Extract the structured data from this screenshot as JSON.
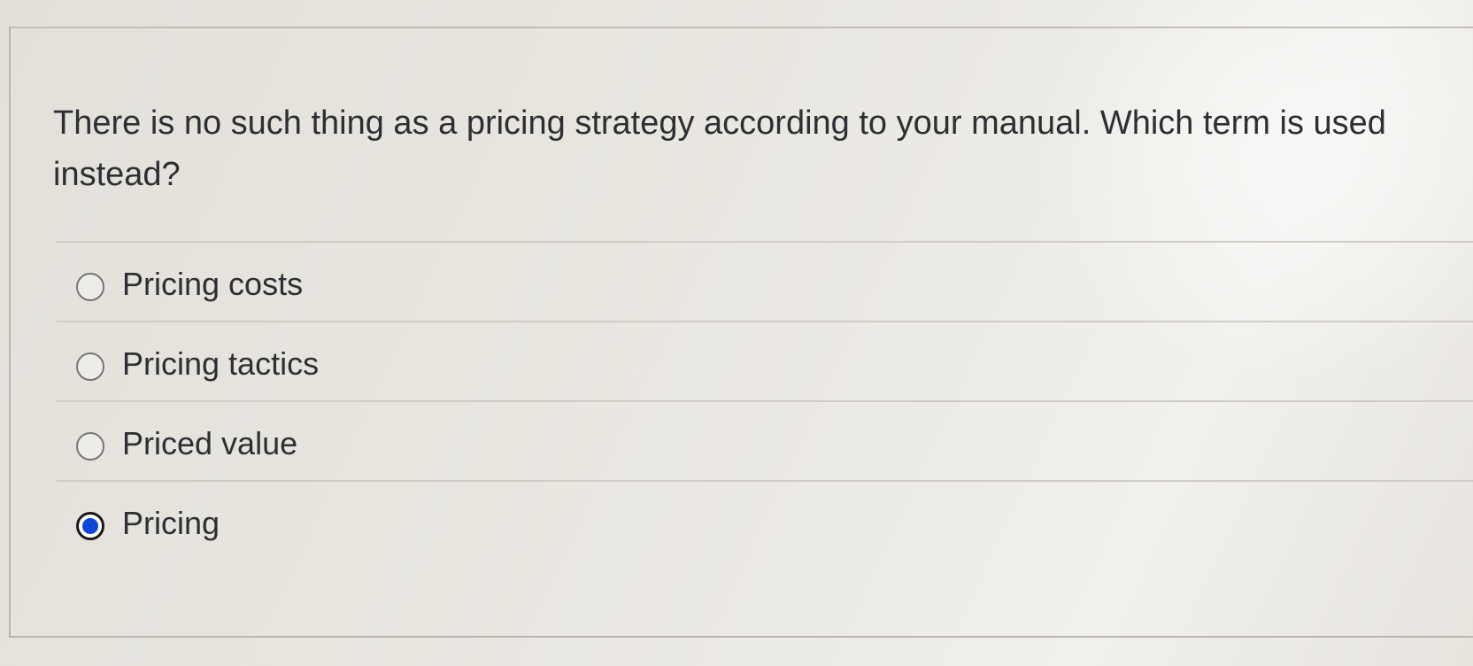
{
  "question": {
    "text": "There is no such thing as a pricing strategy according to your manual. Which term is used instead?"
  },
  "options": [
    {
      "label": "Pricing costs",
      "selected": false
    },
    {
      "label": "Pricing tactics",
      "selected": false
    },
    {
      "label": "Priced value",
      "selected": false
    },
    {
      "label": "Pricing",
      "selected": true
    }
  ],
  "colors": {
    "selected_radio": "#0b47d9"
  },
  "icons": {
    "radio_unselected": "radio-unselected-icon",
    "radio_selected": "radio-selected-icon"
  }
}
